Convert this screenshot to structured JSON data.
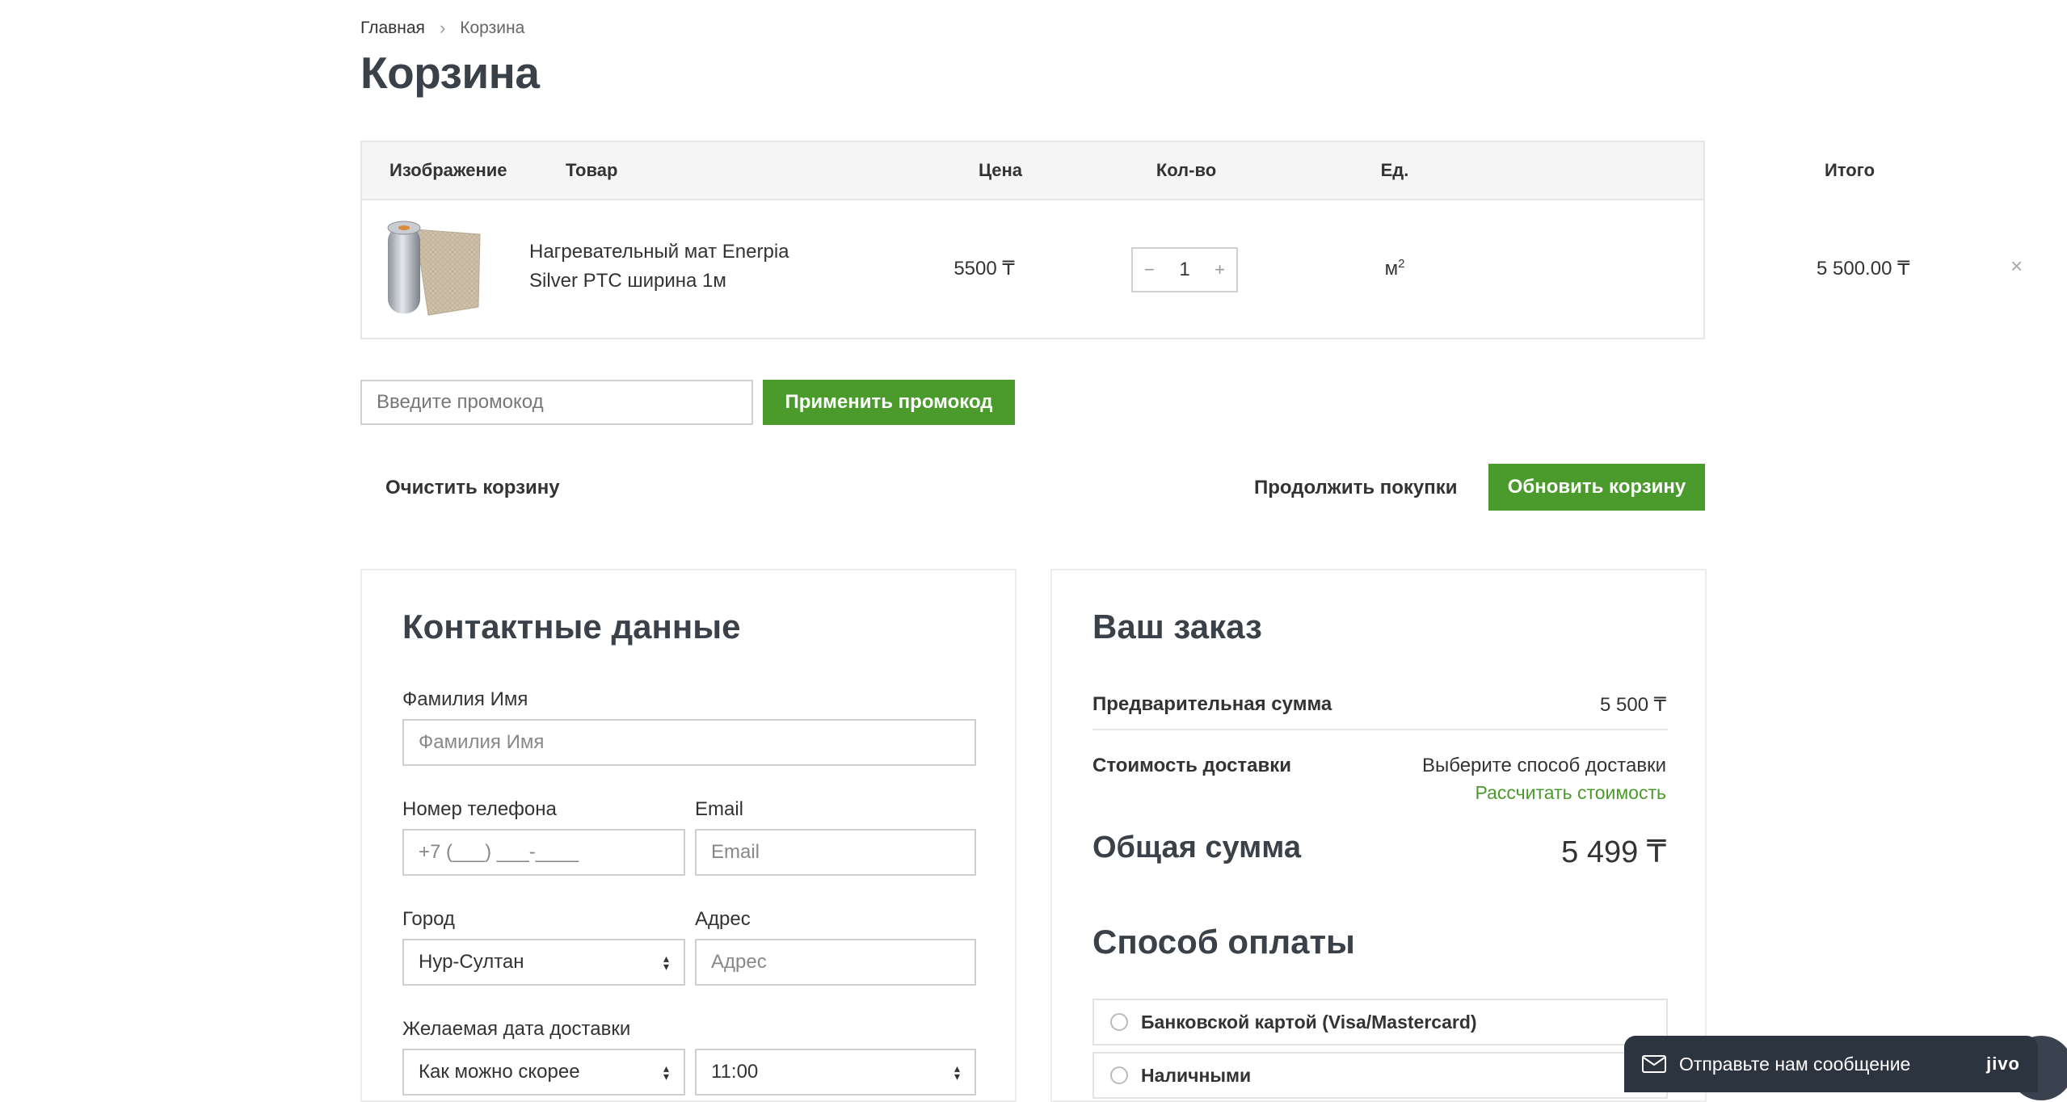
{
  "breadcrumb": {
    "home": "Главная",
    "current": "Корзина"
  },
  "page_title": "Корзина",
  "cart": {
    "headers": {
      "image": "Изображение",
      "product": "Товар",
      "price": "Цена",
      "qty": "Кол-во",
      "unit": "Ед.",
      "total": "Итого"
    },
    "items": [
      {
        "name": "Нагревательный мат Enerpia Silver PTC ширина 1м",
        "price": "5500 ₸",
        "qty": "1",
        "unit": "м",
        "unit_sup": "2",
        "total": "5 500.00 ₸"
      }
    ]
  },
  "promo": {
    "placeholder": "Введите промокод",
    "apply_label": "Применить промокод"
  },
  "actions": {
    "clear": "Очистить корзину",
    "continue": "Продолжить покупки",
    "update": "Обновить корзину"
  },
  "contacts": {
    "title": "Контактные данные",
    "name_label": "Фамилия Имя",
    "name_placeholder": "Фамилия Имя",
    "phone_label": "Номер телефона",
    "phone_placeholder": "+7 (___) ___-____",
    "email_label": "Email",
    "email_placeholder": "Email",
    "city_label": "Город",
    "city_value": "Нур-Султан",
    "address_label": "Адрес",
    "address_placeholder": "Адрес",
    "date_label": "Желаемая дата доставки",
    "date_value": "Как можно скорее",
    "time_value": "11:00"
  },
  "order": {
    "title": "Ваш заказ",
    "subtotal_label": "Предварительная сумма",
    "subtotal_value": "5 500 ₸",
    "delivery_label": "Стоимость доставки",
    "delivery_value": "Выберите способ доставки",
    "delivery_link": "Рассчитать стоимость",
    "grand_label": "Общая сумма",
    "grand_value": "5 499 ₸",
    "payment_title": "Способ оплаты",
    "payment_options": [
      "Банковской картой (Visa/Mastercard)",
      "Наличными"
    ]
  },
  "chat": {
    "label": "Отправьте нам сообщение",
    "brand": "jivo"
  },
  "colors": {
    "accent": "#4a9a2c",
    "text": "#333b45",
    "border": "#e6e6e6"
  },
  "icons": {
    "remove": "close-icon",
    "chat": "envelope-icon",
    "breadcrumb_sep": "chevron-right-icon"
  }
}
